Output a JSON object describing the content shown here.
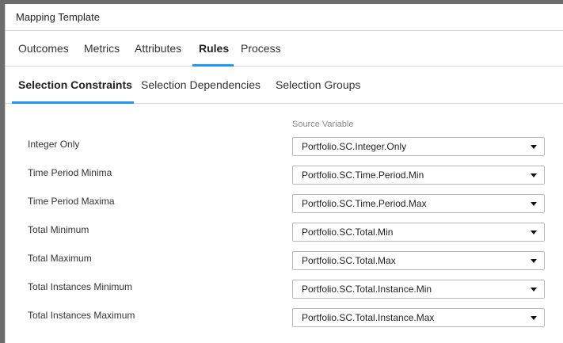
{
  "dialog": {
    "title": "Mapping Template"
  },
  "tabs": [
    "Outcomes",
    "Metrics",
    "Attributes",
    "Rules",
    "Process"
  ],
  "active_tab": "Rules",
  "subtabs": [
    "Selection Constraints",
    "Selection Dependencies",
    "Selection Groups"
  ],
  "active_subtab": "Selection Constraints",
  "form": {
    "column_header": "Source Variable",
    "rows": [
      {
        "label": "Integer Only",
        "value": "Portfolio.SC.Integer.Only"
      },
      {
        "label": "Time Period Minima",
        "value": "Portfolio.SC.Time.Period.Min"
      },
      {
        "label": "Time Period Maxima",
        "value": "Portfolio.SC.Time.Period.Max"
      },
      {
        "label": "Total Minimum",
        "value": "Portfolio.SC.Total.Min"
      },
      {
        "label": "Total Maximum",
        "value": "Portfolio.SC.Total.Max"
      },
      {
        "label": "Total Instances Minimum",
        "value": "Portfolio.SC.Total.Instance.Min"
      },
      {
        "label": "Total Instances Maximum",
        "value": "Portfolio.SC.Total.Instance.Max"
      }
    ]
  },
  "colors": {
    "accent": "#2196f3",
    "backdrop": "#6c6c6c"
  }
}
